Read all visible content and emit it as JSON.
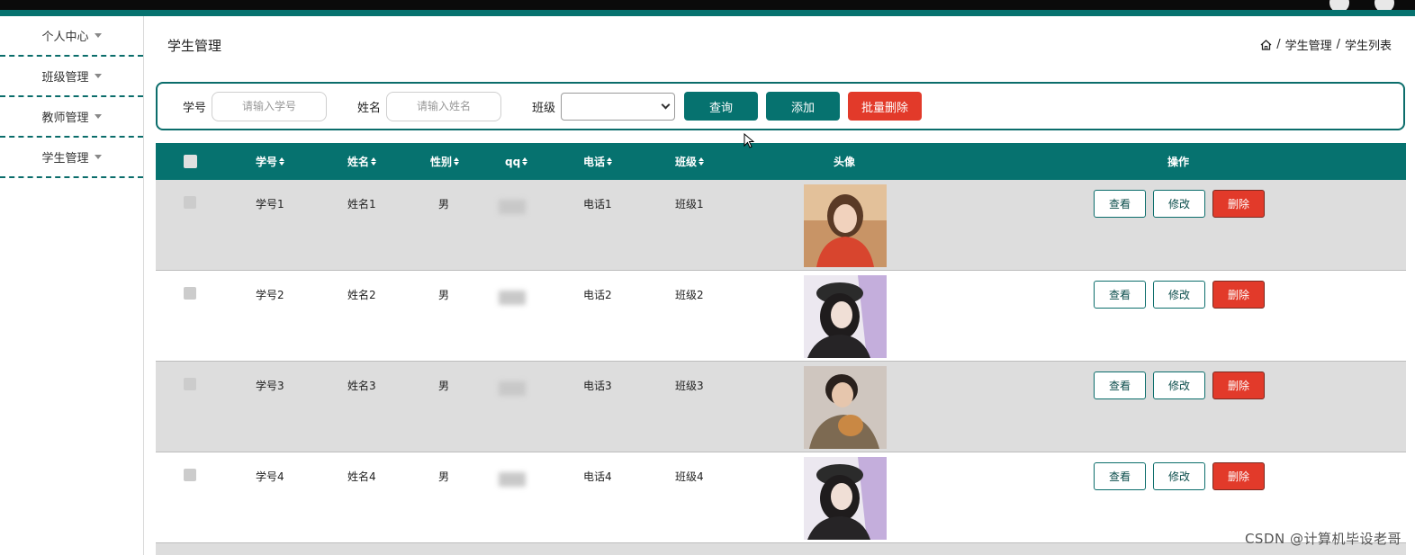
{
  "sidebar": {
    "items": [
      {
        "label": "个人中心"
      },
      {
        "label": "班级管理"
      },
      {
        "label": "教师管理"
      },
      {
        "label": "学生管理"
      }
    ]
  },
  "header": {
    "title": "学生管理",
    "breadcrumb": [
      "学生管理",
      "学生列表"
    ],
    "breadcrumb_sep": "/"
  },
  "search": {
    "id_label": "学号",
    "id_placeholder": "请输入学号",
    "name_label": "姓名",
    "name_placeholder": "请输入姓名",
    "class_label": "班级",
    "class_value": "",
    "query_button": "查询",
    "add_button": "添加",
    "batch_delete_button": "批量删除"
  },
  "table": {
    "headers": {
      "id": "学号",
      "name": "姓名",
      "gender": "性别",
      "qq": "qq",
      "phone": "电话",
      "class": "班级",
      "avatar": "头像",
      "actions": "操作"
    },
    "rows": [
      {
        "id": "学号1",
        "name": "姓名1",
        "gender": "男",
        "phone": "电话1",
        "class": "班级1"
      },
      {
        "id": "学号2",
        "name": "姓名2",
        "gender": "男",
        "phone": "电话2",
        "class": "班级2"
      },
      {
        "id": "学号3",
        "name": "姓名3",
        "gender": "男",
        "phone": "电话3",
        "class": "班级3"
      },
      {
        "id": "学号4",
        "name": "姓名4",
        "gender": "男",
        "phone": "电话4",
        "class": "班级4"
      }
    ],
    "actions": {
      "view": "查看",
      "edit": "修改",
      "delete": "删除"
    }
  },
  "watermark": "CSDN @计算机毕设老哥",
  "colors": {
    "primary": "#06726f",
    "danger": "#e23a2a",
    "topbar": "#0b0b0b"
  }
}
